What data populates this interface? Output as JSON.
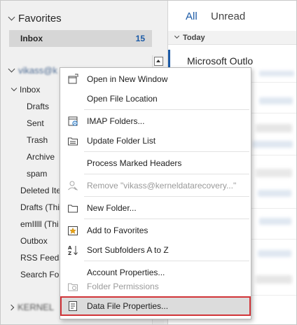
{
  "favorites": {
    "header": "Favorites",
    "inbox_label": "Inbox",
    "inbox_count": "15"
  },
  "account": {
    "name_blurred": "vikass@k",
    "second_blurred": "KERNEL"
  },
  "folders": {
    "inbox": "Inbox",
    "drafts": "Drafts",
    "sent": "Sent",
    "trash": "Trash",
    "archive": "Archive",
    "spam": "spam",
    "deleted": "Deleted Ite",
    "drafts_this": "Drafts (Thi",
    "emllll": "emIllll (Thi",
    "outbox": "Outbox",
    "rss": "RSS Feeds",
    "search": "Search Fold"
  },
  "message_list": {
    "tab_all": "All",
    "tab_unread": "Unread",
    "group_today": "Today",
    "first_sender": "Microsoft Outlo"
  },
  "context_menu": {
    "open_new_window": "Open in New Window",
    "open_file_location": "Open File Location",
    "imap_folders": "IMAP Folders...",
    "update_folder_list": "Update Folder List",
    "process_marked_headers": "Process Marked Headers",
    "remove_account": "Remove \"vikass@kerneldatarecovery...\"",
    "new_folder": "New Folder...",
    "add_to_favorites": "Add to Favorites",
    "sort_subfolders": "Sort Subfolders A to Z",
    "account_properties": "Account Properties...",
    "folder_permissions": "Folder Permissions",
    "data_file_properties": "Data File Properties..."
  },
  "colors": {
    "accent": "#1b5aa6",
    "highlight_border": "#d13438"
  }
}
